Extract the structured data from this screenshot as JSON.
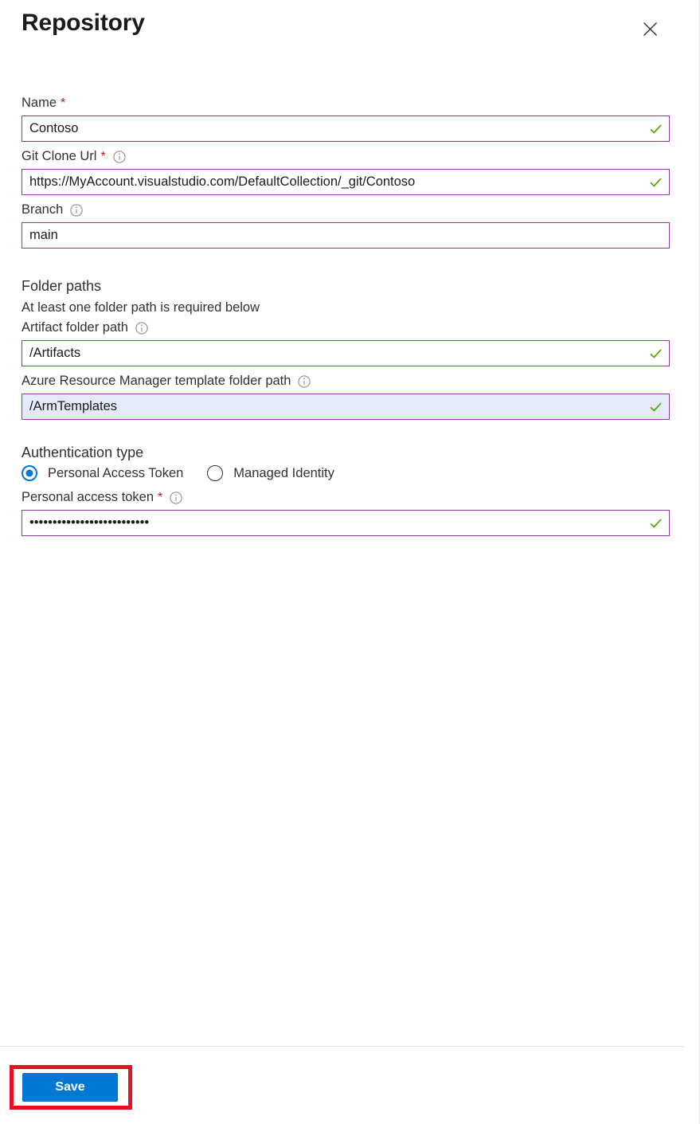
{
  "header": {
    "title": "Repository",
    "close_icon": "close-icon"
  },
  "form": {
    "name": {
      "label": "Name",
      "required_marker": "*",
      "value": "Contoso",
      "validated": true
    },
    "git_clone_url": {
      "label": "Git Clone Url",
      "required_marker": "*",
      "info_icon": "info-icon",
      "value": "https://MyAccount.visualstudio.com/DefaultCollection/_git/Contoso",
      "validated": true
    },
    "branch": {
      "label": "Branch",
      "info_icon": "info-icon",
      "value": "main",
      "validated": false
    },
    "folder_paths": {
      "section_title": "Folder paths",
      "note": "At least one folder path is required below",
      "artifact": {
        "label": "Artifact folder path",
        "info_icon": "info-icon",
        "value": "/Artifacts",
        "validated": true
      },
      "arm_template": {
        "label": "Azure Resource Manager template folder path",
        "info_icon": "info-icon",
        "value": "/ArmTemplates",
        "validated": true,
        "highlighted": true
      }
    },
    "authentication": {
      "section_title": "Authentication type",
      "options": [
        {
          "label": "Personal Access Token",
          "selected": true
        },
        {
          "label": "Managed Identity",
          "selected": false
        }
      ],
      "token": {
        "label": "Personal access token",
        "required_marker": "*",
        "info_icon": "info-icon",
        "value": "••••••••••••••••••••••••••",
        "validated": true
      }
    }
  },
  "footer": {
    "save_label": "Save"
  },
  "colors": {
    "accent_blue": "#0078d4",
    "input_border_purple": "#8e3aab",
    "valid_green": "#57a300",
    "required_red": "#a4262c",
    "highlight_red": "#e81123",
    "focus_background": "#e4eaf9"
  }
}
